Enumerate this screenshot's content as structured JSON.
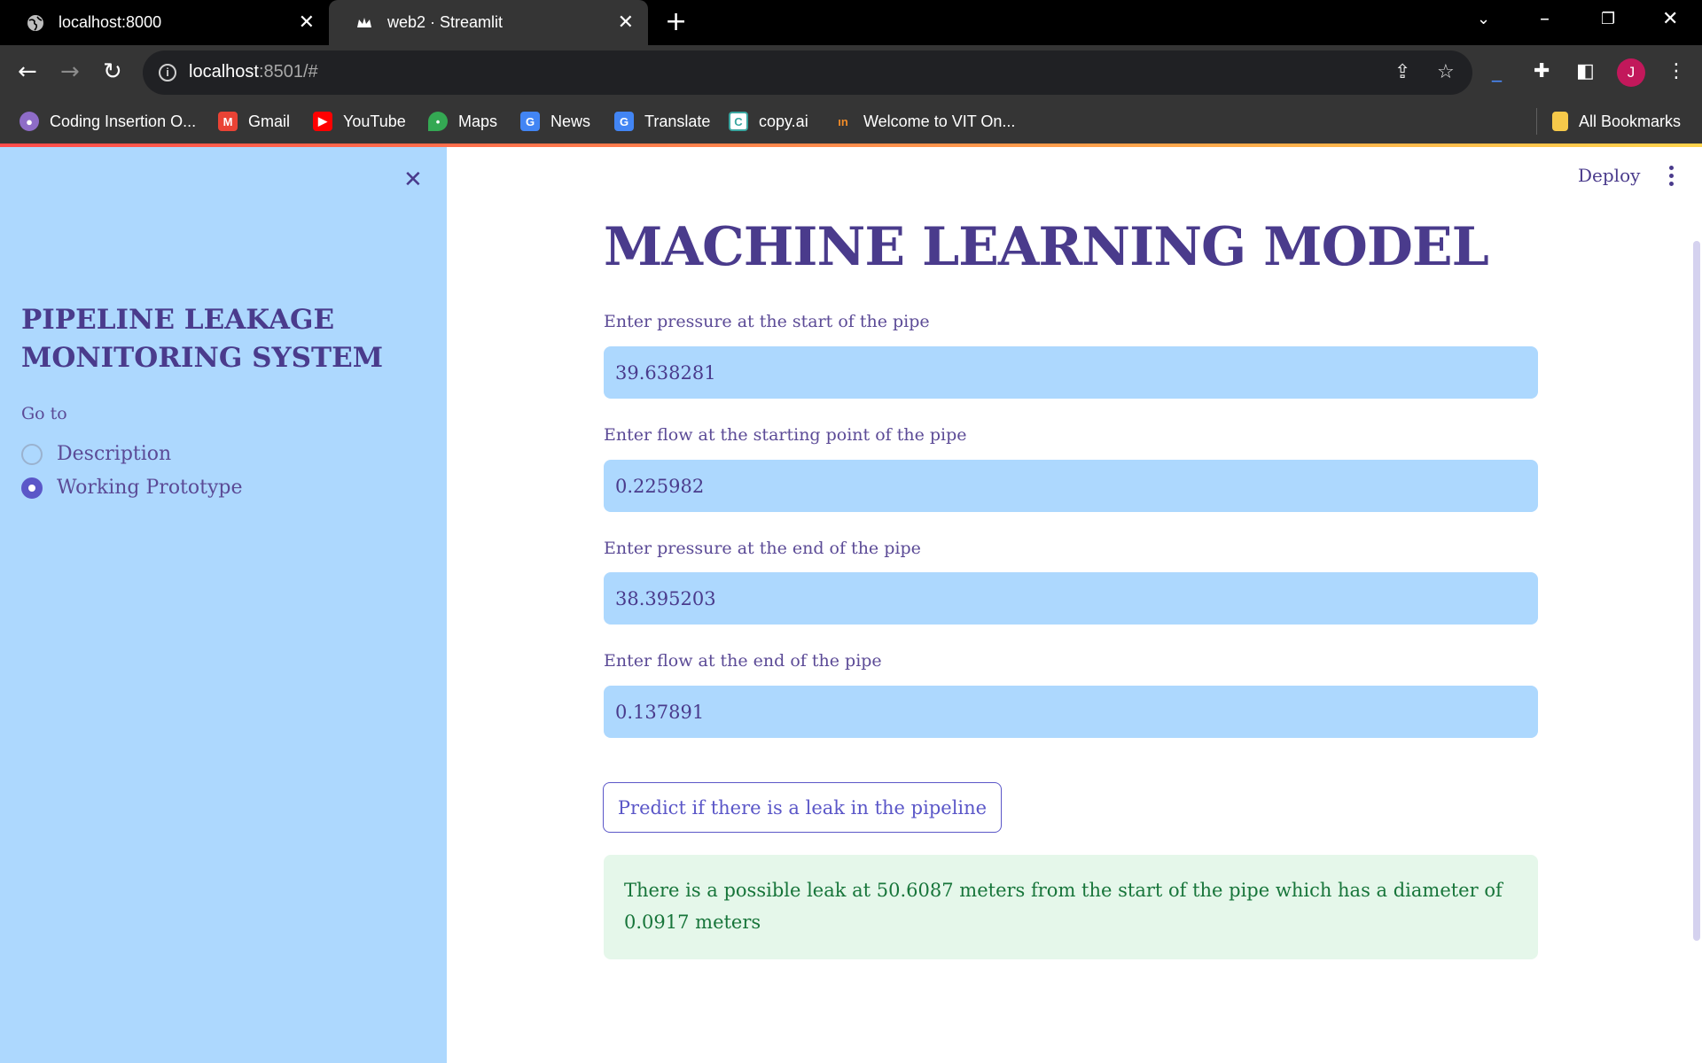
{
  "browser": {
    "tabs": [
      {
        "title": "localhost:8000",
        "icon": "globe-icon",
        "active": false
      },
      {
        "title": "web2 · Streamlit",
        "icon": "streamlit-crown-icon",
        "active": true
      }
    ],
    "new_tab": "+",
    "address": {
      "host": "localhost",
      "rest": ":8501/#"
    },
    "profile_initial": "J",
    "bookmarks": [
      {
        "label": "Coding Insertion O...",
        "icon": "profile-avatar-icon",
        "color": "#8e6cc7"
      },
      {
        "label": "Gmail",
        "icon": "gmail-icon",
        "color": "#ea4335"
      },
      {
        "label": "YouTube",
        "icon": "youtube-icon",
        "color": "#ff0000"
      },
      {
        "label": "Maps",
        "icon": "maps-pin-icon",
        "color": "#34a853"
      },
      {
        "label": "News",
        "icon": "google-news-icon",
        "color": "#4285f4"
      },
      {
        "label": "Translate",
        "icon": "google-translate-icon",
        "color": "#4285f4"
      },
      {
        "label": "copy.ai",
        "icon": "copyai-icon",
        "color": "#3aa6a0"
      },
      {
        "label": "Welcome to VIT On...",
        "icon": "vit-icon",
        "color": "#f28c28"
      }
    ],
    "all_bookmarks": "All Bookmarks"
  },
  "sidebar": {
    "title": "PIPELINE LEAKAGE MONITORING SYSTEM",
    "goto_label": "Go to",
    "options": [
      {
        "label": "Description",
        "selected": false
      },
      {
        "label": "Working Prototype",
        "selected": true
      }
    ]
  },
  "main": {
    "deploy_label": "Deploy",
    "title": "MACHINE LEARNING MODEL",
    "fields": [
      {
        "label": "Enter pressure at the start of the pipe",
        "value": "39.638281"
      },
      {
        "label": "Enter flow at the starting point of the pipe",
        "value": "0.225982"
      },
      {
        "label": "Enter pressure at the end of the pipe",
        "value": "38.395203"
      },
      {
        "label": "Enter flow at the end of the pipe",
        "value": "0.137891"
      }
    ],
    "predict_button": "Predict if there is a leak in the pipeline",
    "result": "There is a possible leak at 50.6087 meters from the start of the pipe which has a diameter of 0.0917 meters"
  },
  "colors": {
    "accent": "#4a3b8c",
    "sidebar_bg": "#add8fe",
    "success_bg": "#e5f7ea",
    "success_text": "#17753a"
  }
}
